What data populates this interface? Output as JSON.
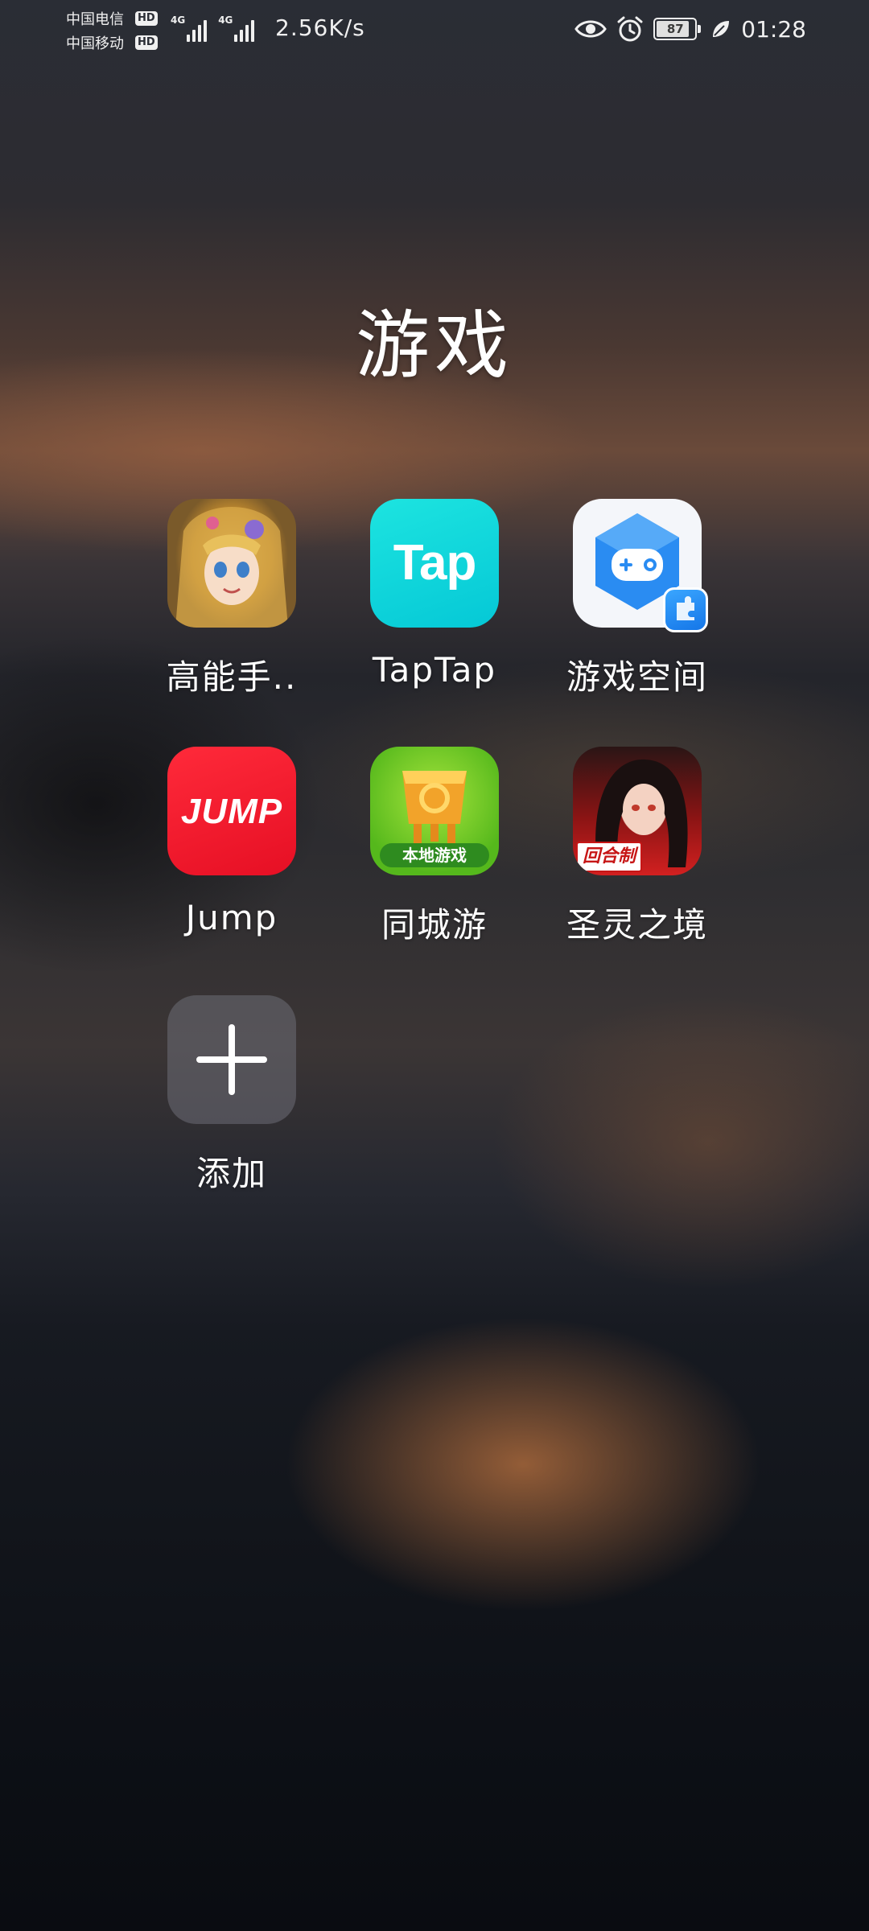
{
  "status_bar": {
    "carriers": [
      {
        "name": "中国电信",
        "badge": "HD"
      },
      {
        "name": "中国移动",
        "badge": "HD"
      }
    ],
    "signals": [
      {
        "type": "4G"
      },
      {
        "type": "4G"
      }
    ],
    "net_speed": "2.56K/s",
    "icons": [
      "eye-icon",
      "alarm-icon",
      "battery-icon",
      "leaf-icon"
    ],
    "battery_level": "87",
    "time": "01:28"
  },
  "folder": {
    "title": "游戏",
    "apps": [
      {
        "label": "高能手..",
        "icon": "anime-girl-game-icon"
      },
      {
        "label": "TapTap",
        "icon": "taptap-icon",
        "icon_text": "Tap"
      },
      {
        "label": "游戏空间",
        "icon": "game-space-icon"
      },
      {
        "label": "Jump",
        "icon": "jump-icon",
        "icon_text": "JUMP"
      },
      {
        "label": "同城游",
        "icon": "local-games-icon",
        "badge_text": "本地游戏"
      },
      {
        "label": "圣灵之境",
        "icon": "saga-game-icon",
        "badge_text": "回合制"
      },
      {
        "label": "添加",
        "icon": "add-icon"
      }
    ]
  },
  "colors": {
    "taptap": "#0ad4da",
    "jump": "#f21a2e",
    "local_games": "#7cc92c",
    "game_space": "#1f8cf5"
  }
}
